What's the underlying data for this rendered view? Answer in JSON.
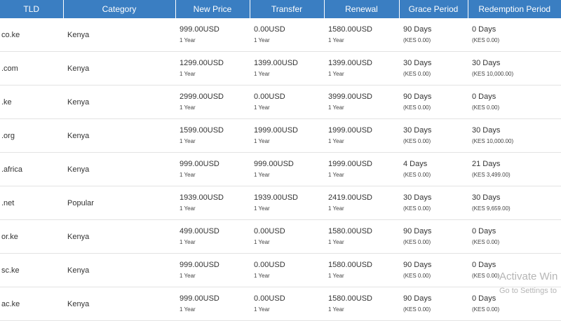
{
  "table": {
    "headers": [
      "TLD",
      "Category",
      "New Price",
      "Transfer",
      "Renewal",
      "Grace Period",
      "Redemption Period"
    ],
    "rows": [
      {
        "tld": "co.ke",
        "category": "Kenya",
        "new_price": "999.00USD",
        "new_term": "1 Year",
        "transfer": "0.00USD",
        "transfer_term": "1 Year",
        "renewal": "1580.00USD",
        "renewal_term": "1 Year",
        "grace": "90 Days",
        "grace_fee": "(KES 0.00)",
        "redemption": "0 Days",
        "redemption_fee": "(KES 0.00)"
      },
      {
        "tld": ".com",
        "category": "Kenya",
        "new_price": "1299.00USD",
        "new_term": "1 Year",
        "transfer": "1399.00USD",
        "transfer_term": "1 Year",
        "renewal": "1399.00USD",
        "renewal_term": "1 Year",
        "grace": "30 Days",
        "grace_fee": "(KES 0.00)",
        "redemption": "30 Days",
        "redemption_fee": "(KES 10,000.00)"
      },
      {
        "tld": ".ke",
        "category": "Kenya",
        "new_price": "2999.00USD",
        "new_term": "1 Year",
        "transfer": "0.00USD",
        "transfer_term": "1 Year",
        "renewal": "3999.00USD",
        "renewal_term": "1 Year",
        "grace": "90 Days",
        "grace_fee": "(KES 0.00)",
        "redemption": "0 Days",
        "redemption_fee": "(KES 0.00)"
      },
      {
        "tld": ".org",
        "category": "Kenya",
        "new_price": "1599.00USD",
        "new_term": "1 Year",
        "transfer": "1999.00USD",
        "transfer_term": "1 Year",
        "renewal": "1999.00USD",
        "renewal_term": "1 Year",
        "grace": "30 Days",
        "grace_fee": "(KES 0.00)",
        "redemption": "30 Days",
        "redemption_fee": "(KES 10,000.00)"
      },
      {
        "tld": ".africa",
        "category": "Kenya",
        "new_price": "999.00USD",
        "new_term": "1 Year",
        "transfer": "999.00USD",
        "transfer_term": "1 Year",
        "renewal": "1999.00USD",
        "renewal_term": "1 Year",
        "grace": "4 Days",
        "grace_fee": "(KES 0.00)",
        "redemption": "21 Days",
        "redemption_fee": "(KES 3,499.00)"
      },
      {
        "tld": ".net",
        "category": "Popular",
        "new_price": "1939.00USD",
        "new_term": "1 Year",
        "transfer": "1939.00USD",
        "transfer_term": "1 Year",
        "renewal": "2419.00USD",
        "renewal_term": "1 Year",
        "grace": "30 Days",
        "grace_fee": "(KES 0.00)",
        "redemption": "30 Days",
        "redemption_fee": "(KES 9,659.00)"
      },
      {
        "tld": "or.ke",
        "category": "Kenya",
        "new_price": "499.00USD",
        "new_term": "1 Year",
        "transfer": "0.00USD",
        "transfer_term": "1 Year",
        "renewal": "1580.00USD",
        "renewal_term": "1 Year",
        "grace": "90 Days",
        "grace_fee": "(KES 0.00)",
        "redemption": "0 Days",
        "redemption_fee": "(KES 0.00)"
      },
      {
        "tld": "sc.ke",
        "category": "Kenya",
        "new_price": "999.00USD",
        "new_term": "1 Year",
        "transfer": "0.00USD",
        "transfer_term": "1 Year",
        "renewal": "1580.00USD",
        "renewal_term": "1 Year",
        "grace": "90 Days",
        "grace_fee": "(KES 0.00)",
        "redemption": "0 Days",
        "redemption_fee": "(KES 0.00)"
      },
      {
        "tld": "ac.ke",
        "category": "Kenya",
        "new_price": "999.00USD",
        "new_term": "1 Year",
        "transfer": "0.00USD",
        "transfer_term": "1 Year",
        "renewal": "1580.00USD",
        "renewal_term": "1 Year",
        "grace": "90 Days",
        "grace_fee": "(KES 0.00)",
        "redemption": "0 Days",
        "redemption_fee": "(KES 0.00)"
      }
    ]
  },
  "watermark": {
    "line1": "Activate Win",
    "line2": "Go to Settings to"
  },
  "colors": {
    "header_bg": "#3a7ec2",
    "header_text": "#ffffff",
    "row_border": "#e3e3e3"
  }
}
